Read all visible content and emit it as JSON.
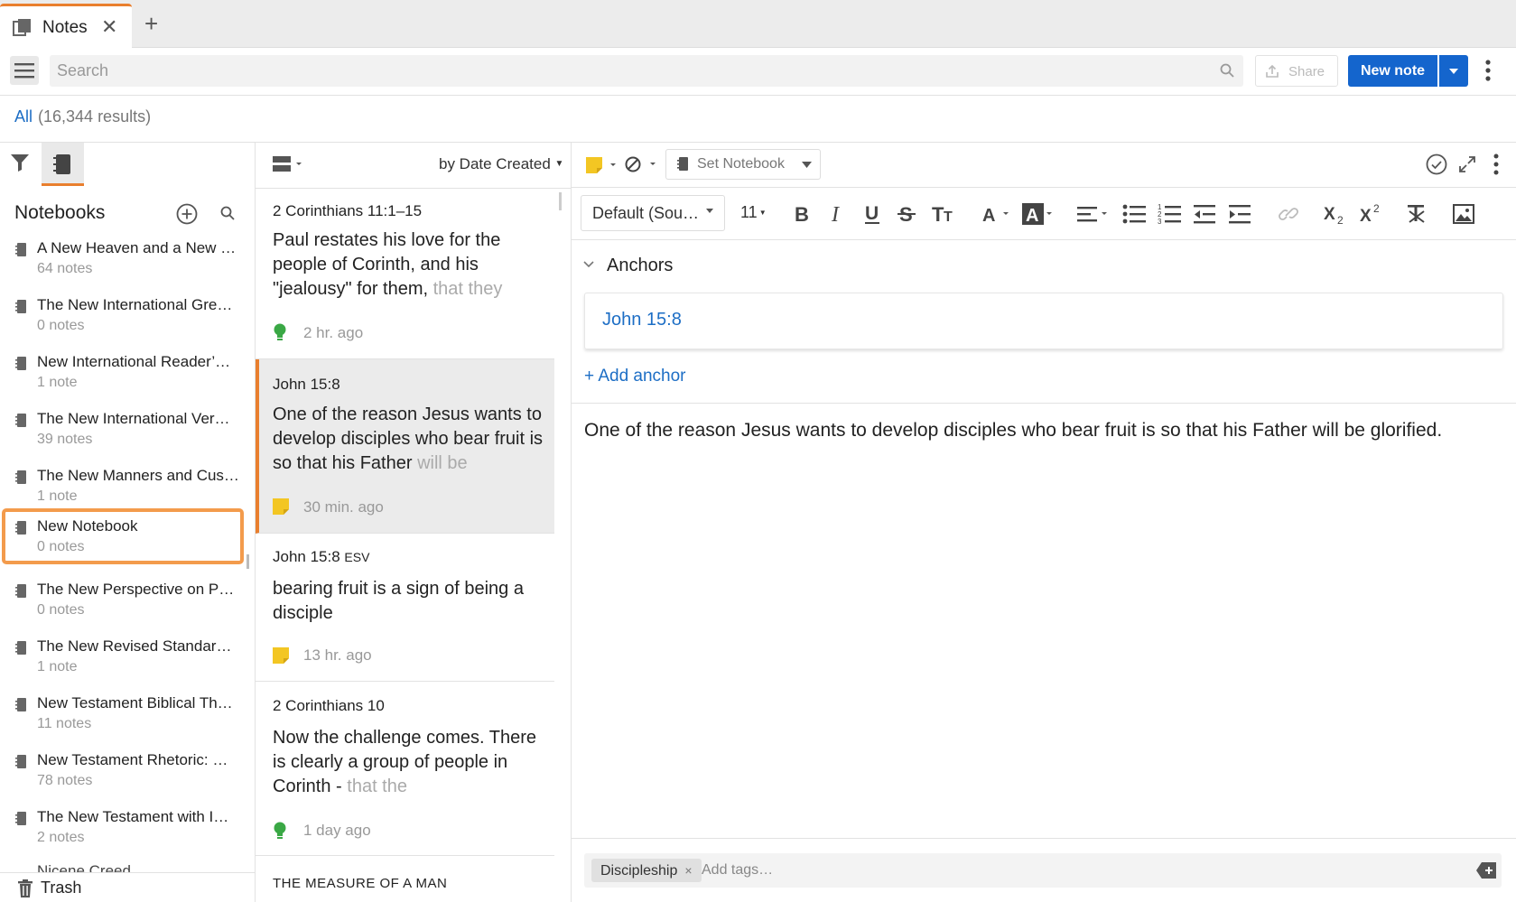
{
  "tab": {
    "title": "Notes"
  },
  "toolbar": {
    "search_placeholder": "Search",
    "share_label": "Share",
    "new_note_label": "New note"
  },
  "results": {
    "scope": "All",
    "count": "(16,344 results)"
  },
  "notebooks": {
    "title": "Notebooks",
    "items": [
      {
        "name": "A New Heaven and a New …",
        "count": "64 notes"
      },
      {
        "name": "The New International Gre…",
        "count": "0 notes"
      },
      {
        "name": "New International Reader’…",
        "count": "1 note"
      },
      {
        "name": "The New International Ver…",
        "count": "39 notes"
      },
      {
        "name": "The New Manners and Cus…",
        "count": "1 note"
      },
      {
        "name": "New Notebook",
        "count": "0 notes",
        "selected": true
      },
      {
        "name": "The New Perspective on P…",
        "count": "0 notes"
      },
      {
        "name": "The New Revised Standard…",
        "count": "1 note"
      },
      {
        "name": "New Testament Biblical Th…",
        "count": "11 notes"
      },
      {
        "name": "New Testament Rhetoric: …",
        "count": "78 notes"
      },
      {
        "name": "The New Testament with I…",
        "count": "2 notes"
      },
      {
        "name": "Nicene Creed",
        "count": ""
      }
    ],
    "trash_label": "Trash"
  },
  "notes_list": {
    "sort_label": "by Date Created",
    "items": [
      {
        "title": "2 Corinthians 11:1–15",
        "body": "Paul restates his love for the people of Corinth, and his \"jealousy\" for them,",
        "body_fade": " that they",
        "time": "2 hr. ago",
        "marker": "bulb"
      },
      {
        "title": "John 15:8",
        "body": "One of the reason Jesus wants to develop disciples who bear fruit is so that his Father",
        "body_fade": " will be",
        "time": "30 min. ago",
        "marker": "note"
      },
      {
        "title": "John 15:8",
        "title_suffix": "ESV",
        "body": "bearing fruit is a sign of being a disciple",
        "body_fade": "",
        "time": "13 hr. ago",
        "marker": "note"
      },
      {
        "title": "2 Corinthians 10",
        "body": "Now the challenge comes. There is clearly a group of people in Corinth -",
        "body_fade": " that the",
        "time": "1 day ago",
        "marker": "bulb"
      },
      {
        "title": "THE MEASURE OF A MAN",
        "body": "",
        "body_fade": "",
        "time": "",
        "marker": ""
      }
    ]
  },
  "editor": {
    "set_notebook_label": "Set Notebook",
    "font_label": "Default (Sou…",
    "size_label": "11",
    "anchors_title": "Anchors",
    "anchor_ref": "John 15:8",
    "add_anchor_label": "+ Add anchor",
    "body": "One of the reason Jesus wants to develop disciples who bear fruit is so that his Father will be glorified.",
    "tag": "Discipleship",
    "tag_remove": "×",
    "add_tags_placeholder": "Add tags…"
  },
  "colors": {
    "accent": "#e97f2e",
    "primary": "#1465cd",
    "link": "#1d6ec5",
    "note_yellow": "#f3c623",
    "bulb_green": "#3aa845"
  }
}
